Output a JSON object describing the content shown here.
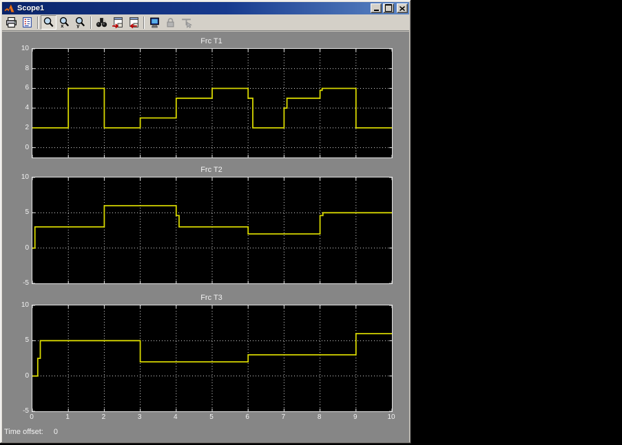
{
  "window": {
    "title": "Scope1"
  },
  "titlebar_buttons": [
    {
      "name": "minimize"
    },
    {
      "name": "maximize"
    },
    {
      "name": "close"
    }
  ],
  "toolbar": {
    "buttons": [
      {
        "name": "print",
        "icon": "printer-icon",
        "group": 1,
        "enabled": true,
        "pressed": false
      },
      {
        "name": "parameters",
        "icon": "parameters-icon",
        "group": 1,
        "enabled": true,
        "pressed": false
      },
      {
        "name": "zoom",
        "icon": "zoom-icon",
        "group": 2,
        "enabled": true,
        "pressed": true
      },
      {
        "name": "zoom-x",
        "icon": "zoom-x-icon",
        "group": 2,
        "enabled": true,
        "pressed": false
      },
      {
        "name": "zoom-y",
        "icon": "zoom-y-icon",
        "group": 2,
        "enabled": true,
        "pressed": false
      },
      {
        "name": "autoscale",
        "icon": "binoculars-icon",
        "group": 3,
        "enabled": true,
        "pressed": false
      },
      {
        "name": "save-axes",
        "icon": "save-axes-icon",
        "group": 3,
        "enabled": true,
        "pressed": false
      },
      {
        "name": "restore-axes",
        "icon": "restore-axes-icon",
        "group": 3,
        "enabled": true,
        "pressed": false
      },
      {
        "name": "floating-scope",
        "icon": "floating-scope-icon",
        "group": 4,
        "enabled": true,
        "pressed": false
      },
      {
        "name": "lock",
        "icon": "lock-icon",
        "group": 4,
        "enabled": false,
        "pressed": false
      },
      {
        "name": "signal-selection",
        "icon": "signal-selection-icon",
        "group": 4,
        "enabled": false,
        "pressed": false
      }
    ]
  },
  "status": {
    "label": "Time offset:",
    "value": "0"
  },
  "colors": {
    "trace": "#d8d800",
    "plot_bg": "#000000",
    "figure_bg": "#868686",
    "grid": "#dcdcdc",
    "text": "#f2f2f2",
    "titlebar_from": "#0a246a",
    "titlebar_to": "#5c86c5"
  },
  "chart_data": [
    {
      "type": "line",
      "title": "Frc T1",
      "xlabel": "",
      "ylabel": "",
      "xlim": [
        0,
        10
      ],
      "ylim": [
        -1,
        10
      ],
      "xticks": [
        0,
        1,
        2,
        3,
        4,
        5,
        6,
        7,
        8,
        9,
        10
      ],
      "xtick_labels": [],
      "yticks": [
        0,
        2,
        4,
        6,
        8,
        10
      ],
      "ytick_labels": [
        "0",
        "2",
        "4",
        "6",
        "8",
        "10"
      ],
      "grid": true,
      "points": [
        [
          0,
          2
        ],
        [
          1,
          2
        ],
        [
          1,
          6
        ],
        [
          2,
          6
        ],
        [
          2,
          2
        ],
        [
          3,
          2
        ],
        [
          3,
          3
        ],
        [
          4,
          3
        ],
        [
          4,
          5
        ],
        [
          5,
          5
        ],
        [
          5,
          6
        ],
        [
          6,
          6
        ],
        [
          6,
          5
        ],
        [
          6.13,
          5
        ],
        [
          6.13,
          2
        ],
        [
          7,
          2
        ],
        [
          7,
          4
        ],
        [
          7.08,
          4
        ],
        [
          7.08,
          5
        ],
        [
          8,
          5
        ],
        [
          8,
          5.8
        ],
        [
          8.06,
          5.8
        ],
        [
          8.06,
          6
        ],
        [
          9,
          6
        ],
        [
          9,
          2
        ],
        [
          10,
          2
        ]
      ]
    },
    {
      "type": "line",
      "title": "Frc T2",
      "xlabel": "",
      "ylabel": "",
      "xlim": [
        0,
        10
      ],
      "ylim": [
        -5,
        10
      ],
      "xticks": [
        0,
        1,
        2,
        3,
        4,
        5,
        6,
        7,
        8,
        9,
        10
      ],
      "xtick_labels": [],
      "yticks": [
        -5,
        0,
        5,
        10
      ],
      "ytick_labels": [
        "-5",
        "0",
        "5",
        "10"
      ],
      "grid": true,
      "points": [
        [
          0,
          0
        ],
        [
          0.07,
          0
        ],
        [
          0.07,
          3
        ],
        [
          2,
          3
        ],
        [
          2,
          6
        ],
        [
          4,
          6
        ],
        [
          4,
          4.6
        ],
        [
          4.08,
          4.6
        ],
        [
          4.08,
          3
        ],
        [
          6,
          3
        ],
        [
          6,
          2
        ],
        [
          8,
          2
        ],
        [
          8,
          4.6
        ],
        [
          8.08,
          4.6
        ],
        [
          8.08,
          5
        ],
        [
          10,
          5
        ]
      ]
    },
    {
      "type": "line",
      "title": "Frc T3",
      "xlabel": "",
      "ylabel": "",
      "xlim": [
        0,
        10
      ],
      "ylim": [
        -5,
        10
      ],
      "xticks": [
        0,
        1,
        2,
        3,
        4,
        5,
        6,
        7,
        8,
        9,
        10
      ],
      "xtick_labels": [
        "0",
        "1",
        "2",
        "3",
        "4",
        "5",
        "6",
        "7",
        "8",
        "9",
        "10"
      ],
      "yticks": [
        -5,
        0,
        5,
        10
      ],
      "ytick_labels": [
        "-5",
        "0",
        "5",
        "10"
      ],
      "grid": true,
      "points": [
        [
          0,
          0
        ],
        [
          0.15,
          0
        ],
        [
          0.15,
          2.5
        ],
        [
          0.22,
          2.5
        ],
        [
          0.22,
          5
        ],
        [
          3,
          5
        ],
        [
          3,
          2
        ],
        [
          6,
          2
        ],
        [
          6,
          3
        ],
        [
          9,
          3
        ],
        [
          9,
          6
        ],
        [
          10,
          6
        ]
      ]
    }
  ]
}
